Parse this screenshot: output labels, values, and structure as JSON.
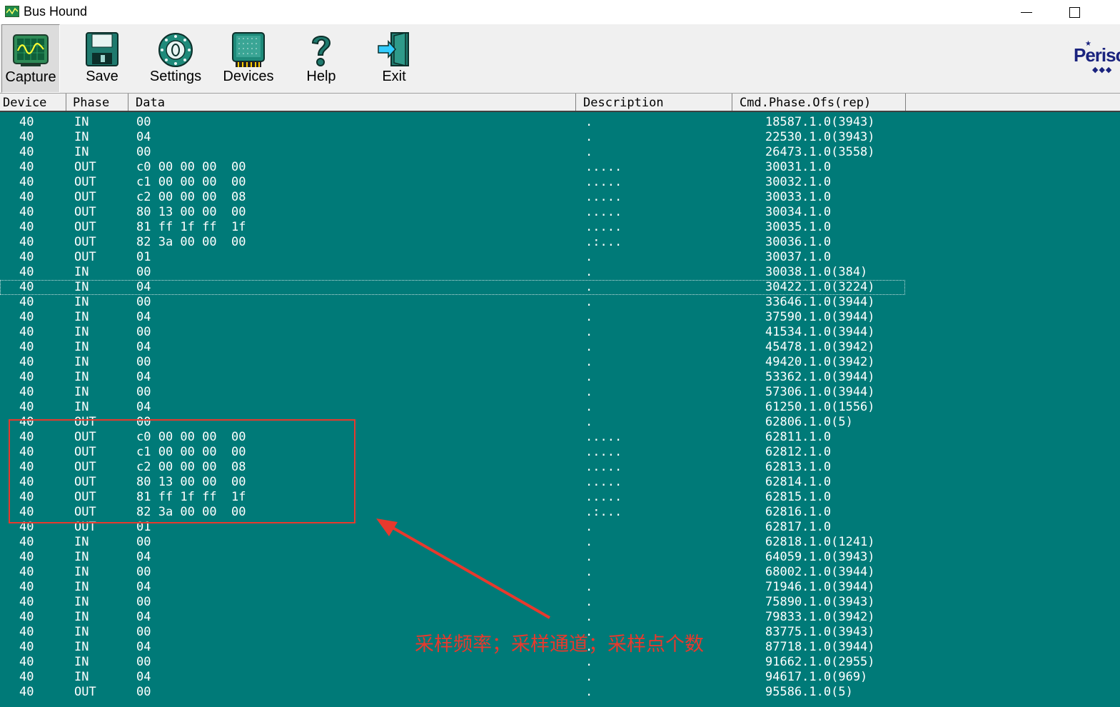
{
  "window": {
    "title": "Bus Hound"
  },
  "toolbar": {
    "buttons": [
      {
        "id": "capture",
        "label": "Capture",
        "icon": "capture-scope-icon"
      },
      {
        "id": "save",
        "label": "Save",
        "icon": "floppy-disk-icon"
      },
      {
        "id": "settings",
        "label": "Settings",
        "icon": "settings-dial-icon"
      },
      {
        "id": "devices",
        "label": "Devices",
        "icon": "device-chip-icon"
      },
      {
        "id": "help",
        "label": "Help",
        "icon": "question-mark-icon"
      },
      {
        "id": "exit",
        "label": "Exit",
        "icon": "exit-door-icon"
      }
    ],
    "logo": "Perisc"
  },
  "columns": [
    "Device",
    "Phase",
    "Data",
    "Description",
    "Cmd.Phase.Ofs(rep)"
  ],
  "rows": [
    {
      "device": "40",
      "phase": "IN",
      "data": "00",
      "desc": ".",
      "cmd": "18587.1.0(3943)"
    },
    {
      "device": "40",
      "phase": "IN",
      "data": "04",
      "desc": ".",
      "cmd": "22530.1.0(3943)"
    },
    {
      "device": "40",
      "phase": "IN",
      "data": "00",
      "desc": ".",
      "cmd": "26473.1.0(3558)"
    },
    {
      "device": "40",
      "phase": "OUT",
      "data": "c0 00 00 00  00",
      "desc": ".....",
      "cmd": "30031.1.0"
    },
    {
      "device": "40",
      "phase": "OUT",
      "data": "c1 00 00 00  00",
      "desc": ".....",
      "cmd": "30032.1.0"
    },
    {
      "device": "40",
      "phase": "OUT",
      "data": "c2 00 00 00  08",
      "desc": ".....",
      "cmd": "30033.1.0"
    },
    {
      "device": "40",
      "phase": "OUT",
      "data": "80 13 00 00  00",
      "desc": ".....",
      "cmd": "30034.1.0"
    },
    {
      "device": "40",
      "phase": "OUT",
      "data": "81 ff 1f ff  1f",
      "desc": ".....",
      "cmd": "30035.1.0"
    },
    {
      "device": "40",
      "phase": "OUT",
      "data": "82 3a 00 00  00",
      "desc": ".:...",
      "cmd": "30036.1.0"
    },
    {
      "device": "40",
      "phase": "OUT",
      "data": "01",
      "desc": ".",
      "cmd": "30037.1.0"
    },
    {
      "device": "40",
      "phase": "IN",
      "data": "00",
      "desc": ".",
      "cmd": "30038.1.0(384)"
    },
    {
      "device": "40",
      "phase": "IN",
      "data": "04",
      "desc": ".",
      "cmd": "30422.1.0(3224)"
    },
    {
      "device": "40",
      "phase": "IN",
      "data": "00",
      "desc": ".",
      "cmd": "33646.1.0(3944)"
    },
    {
      "device": "40",
      "phase": "IN",
      "data": "04",
      "desc": ".",
      "cmd": "37590.1.0(3944)"
    },
    {
      "device": "40",
      "phase": "IN",
      "data": "00",
      "desc": ".",
      "cmd": "41534.1.0(3944)"
    },
    {
      "device": "40",
      "phase": "IN",
      "data": "04",
      "desc": ".",
      "cmd": "45478.1.0(3942)"
    },
    {
      "device": "40",
      "phase": "IN",
      "data": "00",
      "desc": ".",
      "cmd": "49420.1.0(3942)"
    },
    {
      "device": "40",
      "phase": "IN",
      "data": "04",
      "desc": ".",
      "cmd": "53362.1.0(3944)"
    },
    {
      "device": "40",
      "phase": "IN",
      "data": "00",
      "desc": ".",
      "cmd": "57306.1.0(3944)"
    },
    {
      "device": "40",
      "phase": "IN",
      "data": "04",
      "desc": ".",
      "cmd": "61250.1.0(1556)"
    },
    {
      "device": "40",
      "phase": "OUT",
      "data": "00",
      "desc": ".",
      "cmd": "62806.1.0(5)"
    },
    {
      "device": "40",
      "phase": "OUT",
      "data": "c0 00 00 00  00",
      "desc": ".....",
      "cmd": "62811.1.0"
    },
    {
      "device": "40",
      "phase": "OUT",
      "data": "c1 00 00 00  00",
      "desc": ".....",
      "cmd": "62812.1.0"
    },
    {
      "device": "40",
      "phase": "OUT",
      "data": "c2 00 00 00  08",
      "desc": ".....",
      "cmd": "62813.1.0"
    },
    {
      "device": "40",
      "phase": "OUT",
      "data": "80 13 00 00  00",
      "desc": ".....",
      "cmd": "62814.1.0"
    },
    {
      "device": "40",
      "phase": "OUT",
      "data": "81 ff 1f ff  1f",
      "desc": ".....",
      "cmd": "62815.1.0"
    },
    {
      "device": "40",
      "phase": "OUT",
      "data": "82 3a 00 00  00",
      "desc": ".:...",
      "cmd": "62816.1.0"
    },
    {
      "device": "40",
      "phase": "OUT",
      "data": "01",
      "desc": ".",
      "cmd": "62817.1.0"
    },
    {
      "device": "40",
      "phase": "IN",
      "data": "00",
      "desc": ".",
      "cmd": "62818.1.0(1241)"
    },
    {
      "device": "40",
      "phase": "IN",
      "data": "04",
      "desc": ".",
      "cmd": "64059.1.0(3943)"
    },
    {
      "device": "40",
      "phase": "IN",
      "data": "00",
      "desc": ".",
      "cmd": "68002.1.0(3944)"
    },
    {
      "device": "40",
      "phase": "IN",
      "data": "04",
      "desc": ".",
      "cmd": "71946.1.0(3944)"
    },
    {
      "device": "40",
      "phase": "IN",
      "data": "00",
      "desc": ".",
      "cmd": "75890.1.0(3943)"
    },
    {
      "device": "40",
      "phase": "IN",
      "data": "04",
      "desc": ".",
      "cmd": "79833.1.0(3942)"
    },
    {
      "device": "40",
      "phase": "IN",
      "data": "00",
      "desc": ".",
      "cmd": "83775.1.0(3943)"
    },
    {
      "device": "40",
      "phase": "IN",
      "data": "04",
      "desc": ".",
      "cmd": "87718.1.0(3944)"
    },
    {
      "device": "40",
      "phase": "IN",
      "data": "00",
      "desc": ".",
      "cmd": "91662.1.0(2955)"
    },
    {
      "device": "40",
      "phase": "IN",
      "data": "04",
      "desc": ".",
      "cmd": "94617.1.0(969)"
    },
    {
      "device": "40",
      "phase": "OUT",
      "data": "00",
      "desc": ".",
      "cmd": "95586.1.0(5)"
    }
  ],
  "selected_row_index": 11,
  "annotation": {
    "text": "采样频率；采样通道；采样点个数",
    "color": "#e8392d"
  },
  "colors": {
    "grid_background": "#007a78",
    "grid_text": "#ffffff",
    "toolbar_background": "#f0f0f0"
  }
}
